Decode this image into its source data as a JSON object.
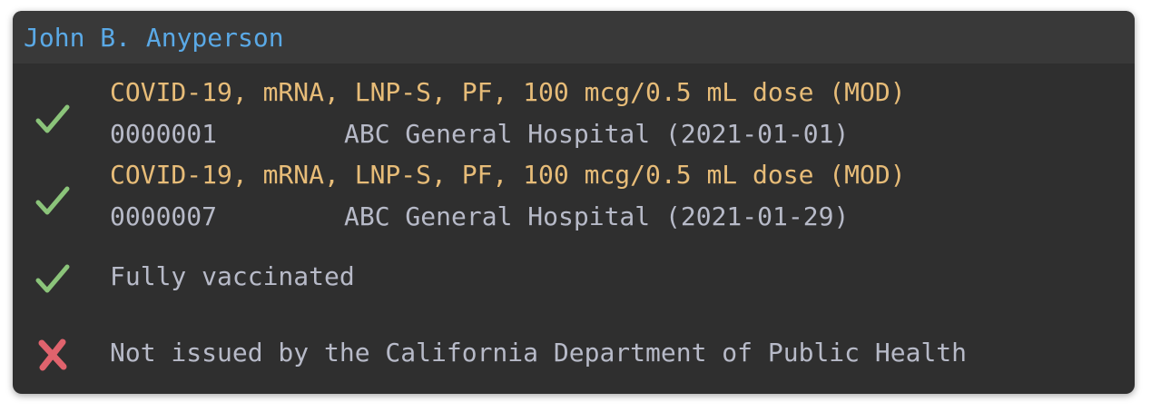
{
  "header": {
    "name": "John B. Anyperson"
  },
  "records": [
    {
      "status_icon": "check-icon",
      "vaccine": "COVID-19, mRNA, LNP-S, PF, 100 mcg/0.5 mL dose (MOD)",
      "lot": "0000001",
      "location_date": "ABC General Hospital (2021-01-01)"
    },
    {
      "status_icon": "check-icon",
      "vaccine": "COVID-19, mRNA, LNP-S, PF, 100 mcg/0.5 mL dose (MOD)",
      "lot": "0000007",
      "location_date": "ABC General Hospital (2021-01-29)"
    }
  ],
  "status": {
    "vaccination": {
      "icon": "check-icon",
      "text": "Fully vaccinated"
    },
    "issuer": {
      "icon": "cross-icon",
      "text": "Not issued by the California Department of Public Health"
    }
  },
  "colors": {
    "background": "#2f2f2f",
    "header_bg": "#393939",
    "name": "#5aa9e6",
    "vaccine": "#e7bc78",
    "detail": "#b7bac8",
    "check": "#8bc47a",
    "cross": "#e0636d"
  }
}
